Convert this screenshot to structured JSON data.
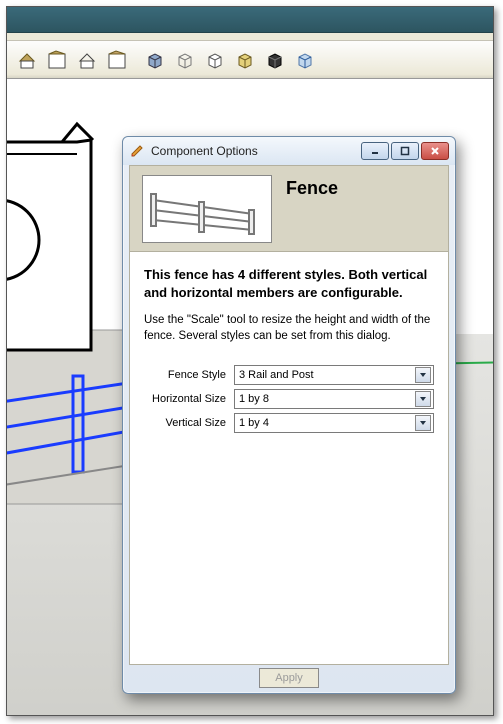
{
  "dialog": {
    "title": "Component Options",
    "component_name": "Fence",
    "description_bold": "This fence has 4 different styles. Both vertical and horizontal members are configurable.",
    "description_plain": "Use the \"Scale\" tool to resize the height and width of the fence. Several styles can be set from this dialog.",
    "fields": {
      "fence_style": {
        "label": "Fence Style",
        "value": "3 Rail and Post"
      },
      "horizontal_size": {
        "label": "Horizontal Size",
        "value": "1 by 8"
      },
      "vertical_size": {
        "label": "Vertical Size",
        "value": "1 by 4"
      }
    },
    "apply_label": "Apply"
  }
}
